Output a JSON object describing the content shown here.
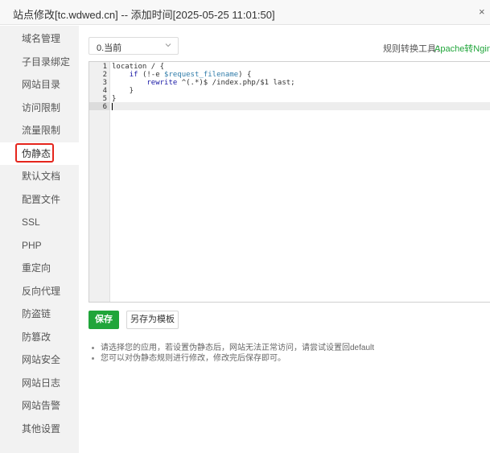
{
  "window": {
    "title": "站点修改[tc.wdwed.cn] -- 添加时间[2025-05-25 11:01:50]",
    "close_label": "×"
  },
  "sidebar": {
    "items": [
      {
        "label": "域名管理"
      },
      {
        "label": "子目录绑定"
      },
      {
        "label": "网站目录"
      },
      {
        "label": "访问限制"
      },
      {
        "label": "流量限制"
      },
      {
        "label": "伪静态",
        "active": true
      },
      {
        "label": "默认文档"
      },
      {
        "label": "配置文件"
      },
      {
        "label": "SSL"
      },
      {
        "label": "PHP"
      },
      {
        "label": "重定向"
      },
      {
        "label": "反向代理"
      },
      {
        "label": "防盗链"
      },
      {
        "label": "防篡改"
      },
      {
        "label": "网站安全"
      },
      {
        "label": "网站日志"
      },
      {
        "label": "网站告警"
      },
      {
        "label": "其他设置"
      }
    ]
  },
  "template_select": {
    "value": "0.当前",
    "icon": "chevron-down-icon"
  },
  "converter": {
    "label": "规则转换工具：",
    "link": "Apache转Nginx",
    "color": "#20a53a"
  },
  "editor": {
    "line_numbers": [
      "1",
      "2",
      "3",
      "4",
      "5",
      "6"
    ],
    "lines": [
      {
        "parts": [
          {
            "t": "location / {",
            "c": "plain"
          }
        ]
      },
      {
        "parts": [
          {
            "t": "    ",
            "c": "plain"
          },
          {
            "t": "if",
            "c": "kw"
          },
          {
            "t": " (!-e ",
            "c": "plain"
          },
          {
            "t": "$request_filename",
            "c": "var"
          },
          {
            "t": ") {",
            "c": "plain"
          }
        ]
      },
      {
        "parts": [
          {
            "t": "        ",
            "c": "plain"
          },
          {
            "t": "rewrite",
            "c": "kw"
          },
          {
            "t": " ^(.*)$ /index.php/$1 last;",
            "c": "plain"
          }
        ]
      },
      {
        "parts": [
          {
            "t": "    }",
            "c": "plain"
          }
        ]
      },
      {
        "parts": [
          {
            "t": "}",
            "c": "plain"
          }
        ]
      },
      {
        "parts": [
          {
            "t": "",
            "c": "plain"
          }
        ]
      }
    ]
  },
  "buttons": {
    "save": "保存",
    "save_as_template": "另存为模板",
    "save_color": "#20a53a"
  },
  "tips": [
    "请选择您的应用，若设置伪静态后，网站无法正常访问，请尝试设置回default",
    "您可以对伪静态规则进行修改，修改完后保存即可。"
  ]
}
